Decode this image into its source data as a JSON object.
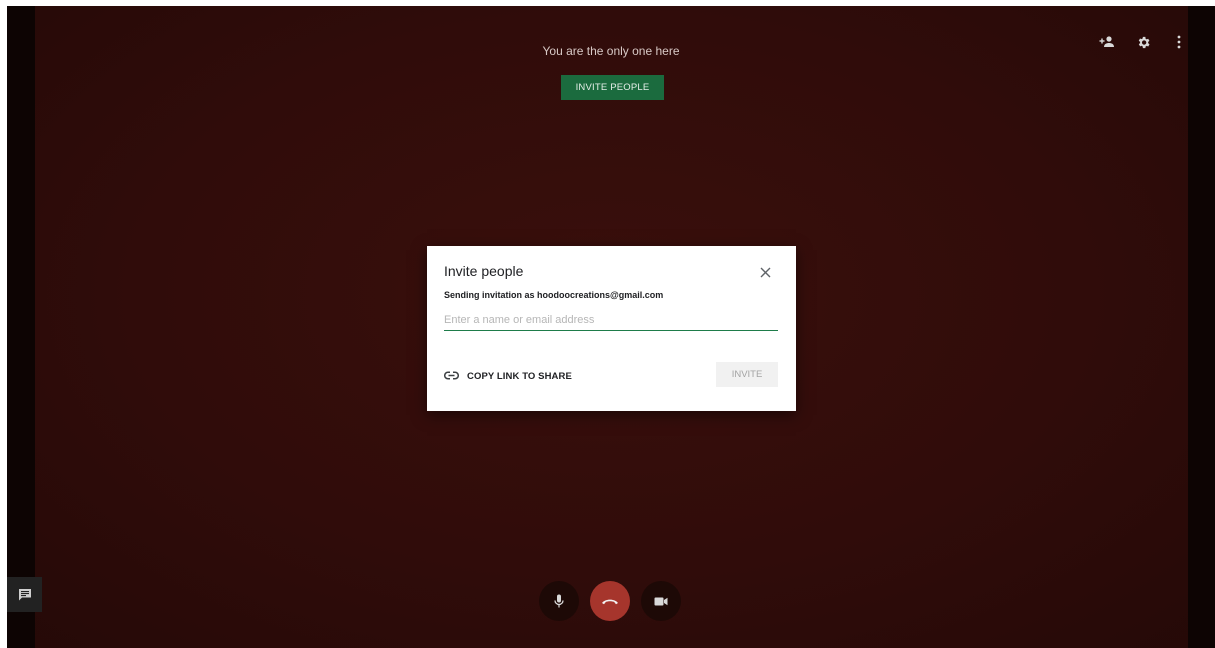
{
  "top": {
    "status_text": "You are the only one here",
    "invite_button_label": "INVITE PEOPLE",
    "icons": [
      "add-person-icon",
      "gear-icon",
      "more-vert-icon"
    ]
  },
  "dialog": {
    "title": "Invite people",
    "sending_as": "Sending invitation as hoodoocreations@gmail.com",
    "input_placeholder": "Enter a name or email address",
    "input_value": "",
    "copy_link_label": "COPY LINK TO SHARE",
    "invite_label": "INVITE"
  },
  "controls": {
    "icons": [
      "mic-icon",
      "hang-up-icon",
      "camera-icon"
    ],
    "chat_icon": "chat-icon"
  },
  "colors": {
    "background": "#300c0a",
    "invite_green": "#1b6b3e",
    "input_underline": "#1e7c4a",
    "hangup_red": "#a6352c"
  }
}
